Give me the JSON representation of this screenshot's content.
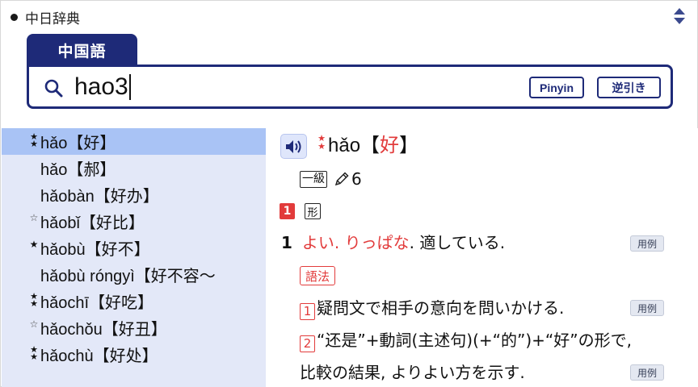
{
  "app": {
    "title": "中日辞典"
  },
  "search": {
    "tab_label": "中国語",
    "query": "hao3",
    "pinyin_button": "Pinyin",
    "reverse_button": "逆引き"
  },
  "results": [
    {
      "pinyin": "hǎo",
      "hanzi": "【好】",
      "stars": 2,
      "star_style": "solid",
      "selected": true
    },
    {
      "pinyin": "hǎo",
      "hanzi": "【郝】",
      "stars": 0,
      "star_style": "none",
      "selected": false
    },
    {
      "pinyin": "hǎobàn",
      "hanzi": "【好办】",
      "stars": 0,
      "star_style": "none",
      "selected": false
    },
    {
      "pinyin": "hǎobǐ",
      "hanzi": "【好比】",
      "stars": 1,
      "star_style": "hollow",
      "selected": false
    },
    {
      "pinyin": "hǎobù",
      "hanzi": "【好不】",
      "stars": 1,
      "star_style": "solid",
      "selected": false
    },
    {
      "pinyin": "hǎobù róngyì",
      "hanzi": "【好不容～",
      "stars": 0,
      "star_style": "none",
      "selected": false
    },
    {
      "pinyin": "hǎochī",
      "hanzi": "【好吃】",
      "stars": 2,
      "star_style": "solid",
      "selected": false
    },
    {
      "pinyin": "hǎochǒu",
      "hanzi": "【好丑】",
      "stars": 1,
      "star_style": "hollow",
      "selected": false
    },
    {
      "pinyin": "hǎochù",
      "hanzi": "【好处】",
      "stars": 2,
      "star_style": "solid",
      "selected": false
    }
  ],
  "entry": {
    "headword_pinyin": "hǎo",
    "headword_hanzi_open": "【",
    "headword_hanzi": "好",
    "headword_hanzi_close": "】",
    "level": "一級",
    "stroke_count": "6",
    "sense_number": "1",
    "part_of_speech": "形",
    "definition_index": "1",
    "definition_red": "よい. りっぱな",
    "definition_rest": ". 適している.",
    "example_label": "用例",
    "usage_label": "語法",
    "usage_items": [
      {
        "num": "1",
        "text": "疑問文で相手の意向を問いかける."
      },
      {
        "num": "2",
        "text": "“还是”+動詞(主述句)(+“的”)+“好”の形で,"
      }
    ],
    "usage_continuation": "比較の結果, よりよい方を示す."
  },
  "colors": {
    "brand_navy": "#1e2a78",
    "accent_red": "#e23b3b",
    "list_bg": "#e3e8f8",
    "list_selected": "#a9c3f5"
  }
}
